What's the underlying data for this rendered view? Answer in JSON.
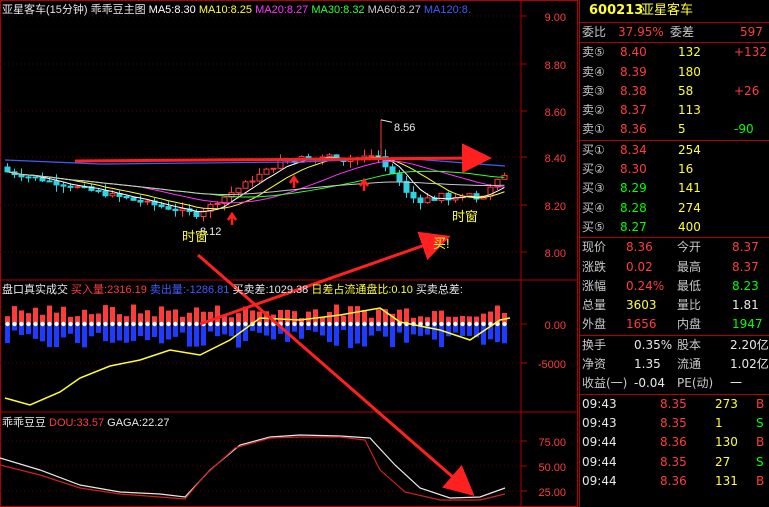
{
  "main_panel": {
    "title_parts": [
      {
        "text": "亚星客车(15分钟)",
        "color": "#e8e8e8"
      },
      {
        "text": "乖乖豆主图",
        "color": "#e8e8e8"
      },
      {
        "text": "MA5:8.30",
        "color": "#ffffff"
      },
      {
        "text": "MA10:8.25",
        "color": "#ffff33"
      },
      {
        "text": "MA20:8.27",
        "color": "#ff33ff"
      },
      {
        "text": "MA30:8.32",
        "color": "#33ff33"
      },
      {
        "text": "MA60:8.27",
        "color": "#c8c8c8"
      },
      {
        "text": "MA120:8.",
        "color": "#3f5cff"
      }
    ],
    "high_label": "8.56",
    "low_label": "8.12",
    "signal_labels": [
      "时窗",
      "时窗"
    ],
    "buy_label": "买!"
  },
  "volume_panel": {
    "title_parts": [
      {
        "text": "盘口真实成交",
        "color": "#e8e8e8"
      },
      {
        "text": "买入量:2316.19",
        "color": "#ff3c3c"
      },
      {
        "text": "卖出量:-1286.81",
        "color": "#3f5cff"
      },
      {
        "text": "买卖差:1029.38",
        "color": "#e8e8e8"
      },
      {
        "text": "日差占流通盘比:0.10",
        "color": "#ffff33"
      },
      {
        "text": "买卖总差:",
        "color": "#e8e8e8"
      }
    ]
  },
  "osc_panel": {
    "title_parts": [
      {
        "text": "乖乖豆豆",
        "color": "#e8e8e8"
      },
      {
        "text": "DOU:33.57",
        "color": "#ff3c3c"
      },
      {
        "text": "GAGA:22.27",
        "color": "#e8e8e8"
      }
    ]
  },
  "axis": {
    "main_ticks": [
      "9.00",
      "8.80",
      "8.60",
      "8.40",
      "8.20",
      "8.00"
    ],
    "volume_ticks": [
      "0.00",
      "-5000"
    ],
    "osc_ticks": [
      "75.00",
      "50.00",
      "25.00"
    ]
  },
  "quote": {
    "code": "600213",
    "name": "亚星客车",
    "weibi_label": "委比",
    "weibi_value": "37.95%",
    "weicha_label": "委差",
    "weicha_value": "597",
    "asks": [
      {
        "label": "卖⑤",
        "price": "8.40",
        "vol": "132",
        "chg": "+132"
      },
      {
        "label": "卖④",
        "price": "8.39",
        "vol": "180",
        "chg": ""
      },
      {
        "label": "卖③",
        "price": "8.38",
        "vol": "58",
        "chg": "+26"
      },
      {
        "label": "卖②",
        "price": "8.37",
        "vol": "113",
        "chg": ""
      },
      {
        "label": "卖①",
        "price": "8.36",
        "vol": "5",
        "chg": "-90"
      }
    ],
    "bids": [
      {
        "label": "买①",
        "price": "8.34",
        "vol": "254"
      },
      {
        "label": "买②",
        "price": "8.30",
        "vol": "16"
      },
      {
        "label": "买③",
        "price": "8.29",
        "vol": "141"
      },
      {
        "label": "买④",
        "price": "8.28",
        "vol": "274"
      },
      {
        "label": "买⑤",
        "price": "8.27",
        "vol": "400"
      }
    ],
    "stats": [
      {
        "l1": "现价",
        "v1": "8.36",
        "c1": "red",
        "l2": "今开",
        "v2": "8.37",
        "c2": "red"
      },
      {
        "l1": "涨跌",
        "v1": "0.02",
        "c1": "red",
        "l2": "最高",
        "v2": "8.37",
        "c2": "red"
      },
      {
        "l1": "涨幅",
        "v1": "0.24%",
        "c1": "red",
        "l2": "最低",
        "v2": "8.23",
        "c2": "grn"
      },
      {
        "l1": "总量",
        "v1": "3603",
        "c1": "yel",
        "l2": "量比",
        "v2": "1.81",
        "c2": "wht"
      },
      {
        "l1": "外盘",
        "v1": "1656",
        "c1": "red",
        "l2": "内盘",
        "v2": "1947",
        "c2": "grn"
      }
    ],
    "fund": [
      {
        "l1": "换手",
        "v1": "0.35%",
        "l2": "股本",
        "v2": "2.20亿"
      },
      {
        "l1": "净资",
        "v1": "1.35",
        "l2": "流通",
        "v2": "1.02亿"
      },
      {
        "l1": "收益(一)",
        "v1": "-0.04",
        "l2": "PE(动)",
        "v2": "一"
      }
    ],
    "ticks": [
      {
        "time": "09:43",
        "price": "8.35",
        "vol": "273",
        "dir": "B",
        "dcolor": "red"
      },
      {
        "time": "09:43",
        "price": "8.35",
        "vol": "1",
        "dir": "S",
        "dcolor": "grn"
      },
      {
        "time": "09:44",
        "price": "8.36",
        "vol": "130",
        "dir": "B",
        "dcolor": "red"
      },
      {
        "time": "09:44",
        "price": "8.35",
        "vol": "27",
        "dir": "S",
        "dcolor": "grn"
      },
      {
        "time": "09:44",
        "price": "8.36",
        "vol": "131",
        "dir": "B",
        "dcolor": "red"
      }
    ]
  },
  "colors": {
    "up": "#ff3c3c",
    "down": "#2fd2e0",
    "grid": "#b00000",
    "annotation": "#ff2020"
  }
}
